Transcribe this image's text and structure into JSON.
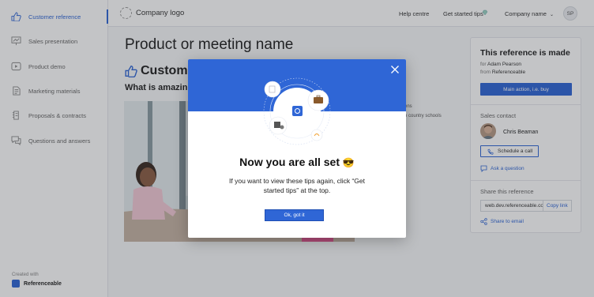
{
  "sidebar": {
    "items": [
      {
        "label": "Customer reference",
        "icon": "thumbs-up-icon",
        "active": true
      },
      {
        "label": "Sales presentation",
        "icon": "presentation-icon"
      },
      {
        "label": "Product demo",
        "icon": "play-icon"
      },
      {
        "label": "Marketing materials",
        "icon": "document-icon"
      },
      {
        "label": "Proposals & contracts",
        "icon": "contract-icon"
      },
      {
        "label": "Questions and answers",
        "icon": "chat-icon"
      }
    ],
    "created_with": "Created with",
    "brand": "Referenceable"
  },
  "topbar": {
    "company_logo": "Company logo",
    "help": "Help centre",
    "tips": "Get started tips",
    "company_name": "Company name",
    "company_chevron": "⌄",
    "avatar": "SP"
  },
  "main": {
    "title": "Product or meeting name",
    "section_title": "Customer reference",
    "subtitle": "What is amazing",
    "text_line1": "ens",
    "text_line2": "e country schools"
  },
  "panel": {
    "title": "This reference is made",
    "for_label": "for",
    "for_name": "Adam Pearson",
    "from_label": "from",
    "from_name": "Referenceable",
    "main_action": "Main action, i.e. buy",
    "sales_contact": "Sales contact",
    "contact_name": "Chris Beaman",
    "schedule": "Schedule a call",
    "ask": "Ask a question",
    "share_title": "Share this reference",
    "url": "web.dev.referenceable.co",
    "copy": "Copy link",
    "share_email": "Share to email"
  },
  "modal": {
    "title": "Now you are all set",
    "emoji": "😎",
    "body": "If you want to view these tips again, click “Get started tips” at the top.",
    "button": "Ok, got it"
  },
  "colors": {
    "accent": "#2f66d6",
    "overlay": "rgba(40,44,52,0.28)"
  }
}
